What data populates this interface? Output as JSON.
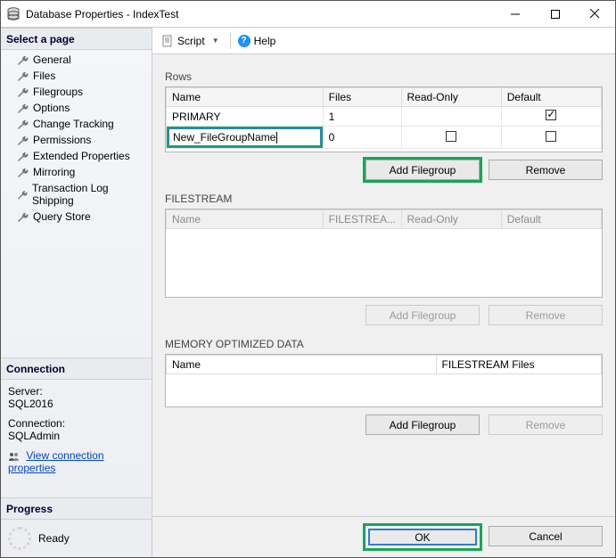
{
  "window": {
    "title": "Database Properties - IndexTest"
  },
  "toolbar": {
    "script": "Script",
    "help": "Help"
  },
  "sidebar": {
    "select_page": "Select a page",
    "items": [
      {
        "label": "General"
      },
      {
        "label": "Files"
      },
      {
        "label": "Filegroups"
      },
      {
        "label": "Options"
      },
      {
        "label": "Change Tracking"
      },
      {
        "label": "Permissions"
      },
      {
        "label": "Extended Properties"
      },
      {
        "label": "Mirroring"
      },
      {
        "label": "Transaction Log Shipping"
      },
      {
        "label": "Query Store"
      }
    ],
    "connection_header": "Connection",
    "server_label": "Server:",
    "server_value": "SQL2016",
    "connection_label": "Connection:",
    "connection_value": "SQLAdmin",
    "view_conn_props": "View connection properties",
    "progress_header": "Progress",
    "progress_state": "Ready"
  },
  "rows_section": {
    "title": "Rows",
    "cols": {
      "name": "Name",
      "files": "Files",
      "readonly": "Read-Only",
      "default": "Default"
    },
    "data": [
      {
        "name": "PRIMARY",
        "files": "1",
        "readonly": null,
        "default": true
      },
      {
        "name": "New_FileGroupName",
        "files": "0",
        "readonly": false,
        "default": false,
        "editing": true
      }
    ],
    "add_btn": "Add Filegroup",
    "remove_btn": "Remove"
  },
  "filestream_section": {
    "title": "FILESTREAM",
    "cols": {
      "name": "Name",
      "fsfiles": "FILESTREA...",
      "readonly": "Read-Only",
      "default": "Default"
    },
    "add_btn": "Add Filegroup",
    "remove_btn": "Remove"
  },
  "mo_section": {
    "title": "MEMORY OPTIMIZED DATA",
    "cols": {
      "name": "Name",
      "fsfiles": "FILESTREAM Files"
    },
    "add_btn": "Add Filegroup",
    "remove_btn": "Remove"
  },
  "footer": {
    "ok": "OK",
    "cancel": "Cancel"
  }
}
